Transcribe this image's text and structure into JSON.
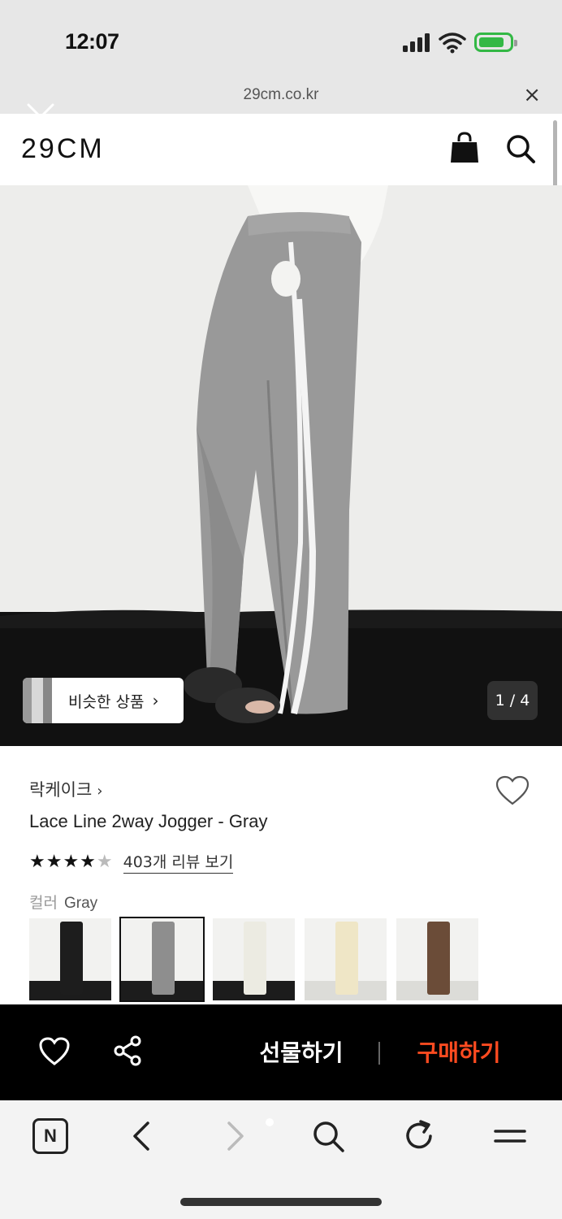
{
  "status": {
    "time": "12:07"
  },
  "browser": {
    "url": "29cm.co.kr",
    "close_symbol": "×"
  },
  "site": {
    "logo": "29CM"
  },
  "hero": {
    "similar_label": "비슷한 상품",
    "similar_chevron": "›",
    "counter": "1 / 4"
  },
  "product": {
    "brand": "락케이크",
    "brand_chevron": "›",
    "name": "Lace Line 2way Jogger - Gray",
    "stars_full": "★★★★",
    "stars_half": "★",
    "rating": 4.5,
    "review_link": "403개 리뷰 보기",
    "color_key": "컬러",
    "color_value": "Gray",
    "swatches": [
      {
        "name": "black",
        "color": "#1d1d1d"
      },
      {
        "name": "gray",
        "color": "#8e8e8e",
        "selected": true
      },
      {
        "name": "cream",
        "color": "#ecebe2"
      },
      {
        "name": "butter",
        "color": "#efe6c6"
      },
      {
        "name": "brown",
        "color": "#6b4c38"
      }
    ]
  },
  "actions": {
    "gift": "선물하기",
    "buy": "구매하기",
    "buy_color": "#ff4b20"
  },
  "toolbar": {
    "n_label": "N"
  }
}
